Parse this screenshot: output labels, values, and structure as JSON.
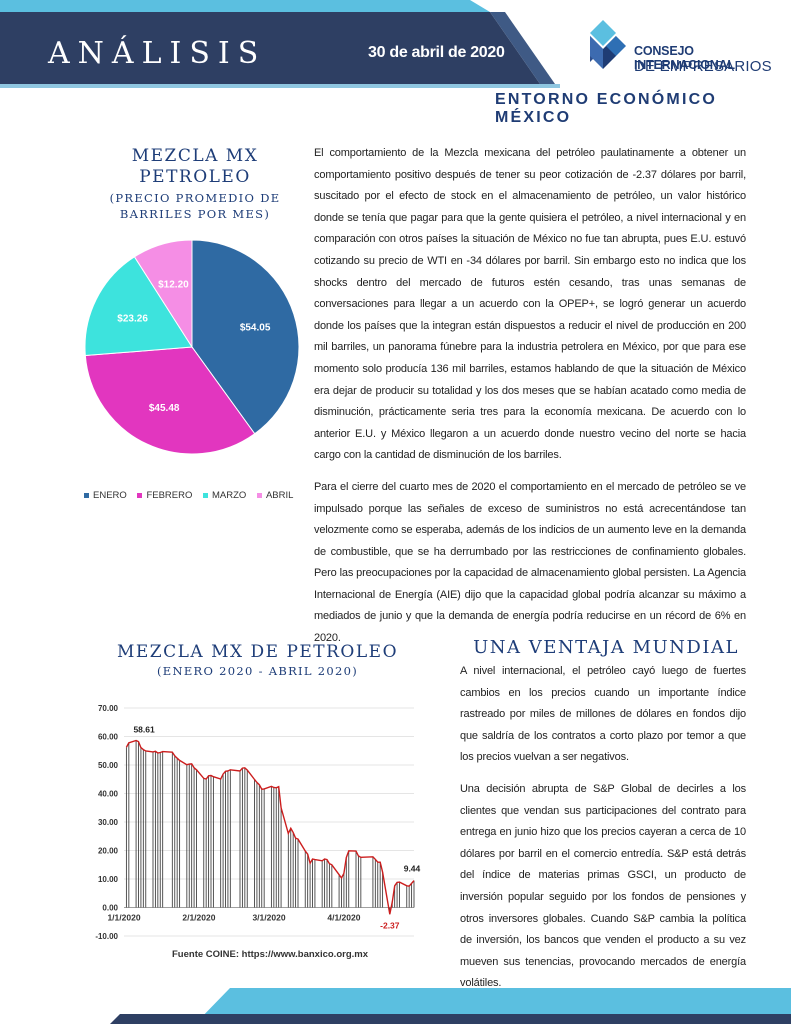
{
  "header": {
    "title": "ANÁLISIS",
    "date": "30 de abril de 2020",
    "logo_line1": "CONSEJO INTERNACIONAL",
    "logo_line2": "DE EMPRESARIOS",
    "subtitle": "ENTORNO ECONÓMICO MÉXICO"
  },
  "colors": {
    "navy": "#2e3f63",
    "teal": "#3aa9c9",
    "brand": "#1f3c74",
    "pie_enero": "#2f6aa3",
    "pie_febrero": "#e236bf",
    "pie_marzo": "#3de3dd",
    "pie_abril": "#f58ee5",
    "line_red": "#cc1e1e"
  },
  "section1": {
    "title_line1": "MEZCLA MX",
    "title_line2": "PETROLEO",
    "subtitle_line1": "(PRECIO PROMEDIO DE",
    "subtitle_line2": "BARRILES POR MES)",
    "paragraph1": "El comportamiento de la Mezcla mexicana del petróleo  paulatinamente a obtener un comportamiento positivo después de tener su peor cotización de -2.37 dólares por barril, suscitado por el efecto de stock en el almacenamiento de petróleo, un valor histórico donde se tenía que pagar para que la gente quisiera el petróleo, a nivel internacional y en comparación con  otros países la situación de México no fue tan abrupta, pues E.U. estuvó cotizando su precio de WTI en -34 dólares por barril. Sin embargo esto no indica que los shocks dentro del mercado de futuros estén cesando, tras unas semanas de conversaciones para llegar a un acuerdo con la OPEP+, se logró generar un acuerdo donde los países que la integran están dispuestos a reducir el nivel de producción en 200 mil barriles, un panorama fúnebre para la industria petrolera en México, por que para ese momento solo producía 136 mil barriles, estamos hablando de que la situación de México era dejar de producir su totalidad y los dos meses que se habían acatado como media de disminución, prácticamente seria tres para la economía mexicana. De acuerdo con lo anterior E.U. y México llegaron a un acuerdo donde nuestro vecino del norte se hacia cargo con la cantidad de disminución de los barriles.",
    "paragraph2": "Para el cierre del cuarto mes de 2020 el comportamiento en el mercado de petróleo se ve impulsado porque las  señales de exceso de suministros no está acrecentándose tan velozmente como se esperaba, además de los indicios de un aumento leve en la demanda de combustible, que se ha derrumbado por las restricciones de confinamiento globales. Pero las preocupaciones por la capacidad de almacenamiento global persisten. La Agencia Internacional de Energía (AIE) dijo que la capacidad global podría alcanzar su máximo a mediados de junio y que la demanda de energía podría reducirse en un récord de 6% en 2020."
  },
  "section2": {
    "title": "MEZCLA MX DE PETROLEO",
    "subtitle": "(ENERO 2020 - ABRIL 2020)",
    "source": "Fuente COINE: https://www.banxico.org.mx"
  },
  "section3": {
    "title": "UNA VENTAJA MUNDIAL",
    "paragraph1": "A nivel internacional, el petróleo cayó luego de fuertes cambios en los precios cuando un importante índice rastreado por miles de millones de dólares en fondos dijo que saldría de los contratos a corto plazo por temor a que los precios vuelvan a ser negativos.",
    "paragraph2": "Una decisión abrupta de S&P Global de decirles a los clientes que vendan sus participaciones del contrato para entrega en junio hizo que los precios cayeran a cerca de 10 dólares por barril en el comercio entredía. S&P está detrás del índice de materias primas GSCI, un producto de inversión popular seguido por los fondos de pensiones y otros inversores globales. Cuando S&P cambia la política de inversión, los bancos que venden el producto a su vez mueven sus tenencias, provocando mercados de energía volátiles."
  },
  "chart_data": [
    {
      "type": "pie",
      "categories": [
        "ENERO",
        "FEBRERO",
        "MARZO",
        "ABRIL"
      ],
      "values": [
        54.05,
        45.48,
        23.26,
        12.2
      ],
      "labels": [
        "$54.05",
        "$45.48",
        "$23.26",
        "$12.20"
      ],
      "legend_position": "bottom"
    },
    {
      "type": "line",
      "ylim": [
        -10,
        70
      ],
      "yticks": [
        "70.00",
        "60.00",
        "50.00",
        "40.00",
        "30.00",
        "20.00",
        "10.00",
        "0.00",
        "-10.00"
      ],
      "xticks": [
        "1/1/2020",
        "2/1/2020",
        "3/1/2020",
        "4/1/2020"
      ],
      "annotations": [
        "58.61",
        "-2.37",
        "9.44"
      ],
      "grid": true,
      "x": [
        "2020-01-02",
        "2020-01-03",
        "2020-01-06",
        "2020-01-07",
        "2020-01-08",
        "2020-01-09",
        "2020-01-10",
        "2020-01-13",
        "2020-01-14",
        "2020-01-15",
        "2020-01-16",
        "2020-01-17",
        "2020-01-21",
        "2020-01-22",
        "2020-01-23",
        "2020-01-24",
        "2020-01-27",
        "2020-01-28",
        "2020-01-29",
        "2020-01-30",
        "2020-01-31",
        "2020-02-03",
        "2020-02-04",
        "2020-02-05",
        "2020-02-06",
        "2020-02-07",
        "2020-02-10",
        "2020-02-11",
        "2020-02-12",
        "2020-02-13",
        "2020-02-14",
        "2020-02-18",
        "2020-02-19",
        "2020-02-20",
        "2020-02-21",
        "2020-02-24",
        "2020-02-25",
        "2020-02-26",
        "2020-02-27",
        "2020-02-28",
        "2020-03-02",
        "2020-03-03",
        "2020-03-04",
        "2020-03-05",
        "2020-03-06",
        "2020-03-09",
        "2020-03-10",
        "2020-03-11",
        "2020-03-12",
        "2020-03-13",
        "2020-03-16",
        "2020-03-17",
        "2020-03-18",
        "2020-03-19",
        "2020-03-20",
        "2020-03-23",
        "2020-03-24",
        "2020-03-25",
        "2020-03-26",
        "2020-03-27",
        "2020-03-30",
        "2020-03-31",
        "2020-04-01",
        "2020-04-02",
        "2020-04-03",
        "2020-04-06",
        "2020-04-07",
        "2020-04-08",
        "2020-04-13",
        "2020-04-14",
        "2020-04-15",
        "2020-04-16",
        "2020-04-17",
        "2020-04-20",
        "2020-04-21",
        "2020-04-22",
        "2020-04-23",
        "2020-04-24",
        "2020-04-27",
        "2020-04-28",
        "2020-04-29",
        "2020-04-30"
      ],
      "values": [
        56.2,
        57.8,
        58.61,
        58.2,
        56.1,
        55.4,
        54.9,
        54.6,
        54.8,
        54.2,
        54.4,
        54.7,
        54.5,
        53.2,
        52.4,
        51.6,
        50.1,
        50.3,
        50.4,
        49.0,
        48.3,
        45.3,
        45.1,
        46.2,
        46.3,
        45.9,
        45.1,
        46.8,
        47.8,
        47.9,
        48.3,
        47.9,
        48.9,
        49.0,
        48.2,
        44.9,
        43.9,
        43.1,
        41.5,
        41.6,
        42.5,
        42.1,
        42.0,
        42.4,
        35.0,
        26.0,
        27.8,
        26.3,
        24.3,
        24.0,
        19.8,
        18.7,
        15.5,
        17.0,
        16.8,
        16.4,
        17.0,
        16.8,
        15.4,
        15.0,
        11.5,
        10.4,
        12.0,
        17.5,
        19.9,
        19.8,
        18.1,
        17.6,
        17.8,
        16.9,
        15.9,
        15.9,
        12.4,
        -2.37,
        2.0,
        7.6,
        8.8,
        8.9,
        7.6,
        7.5,
        8.5,
        9.44
      ]
    }
  ]
}
